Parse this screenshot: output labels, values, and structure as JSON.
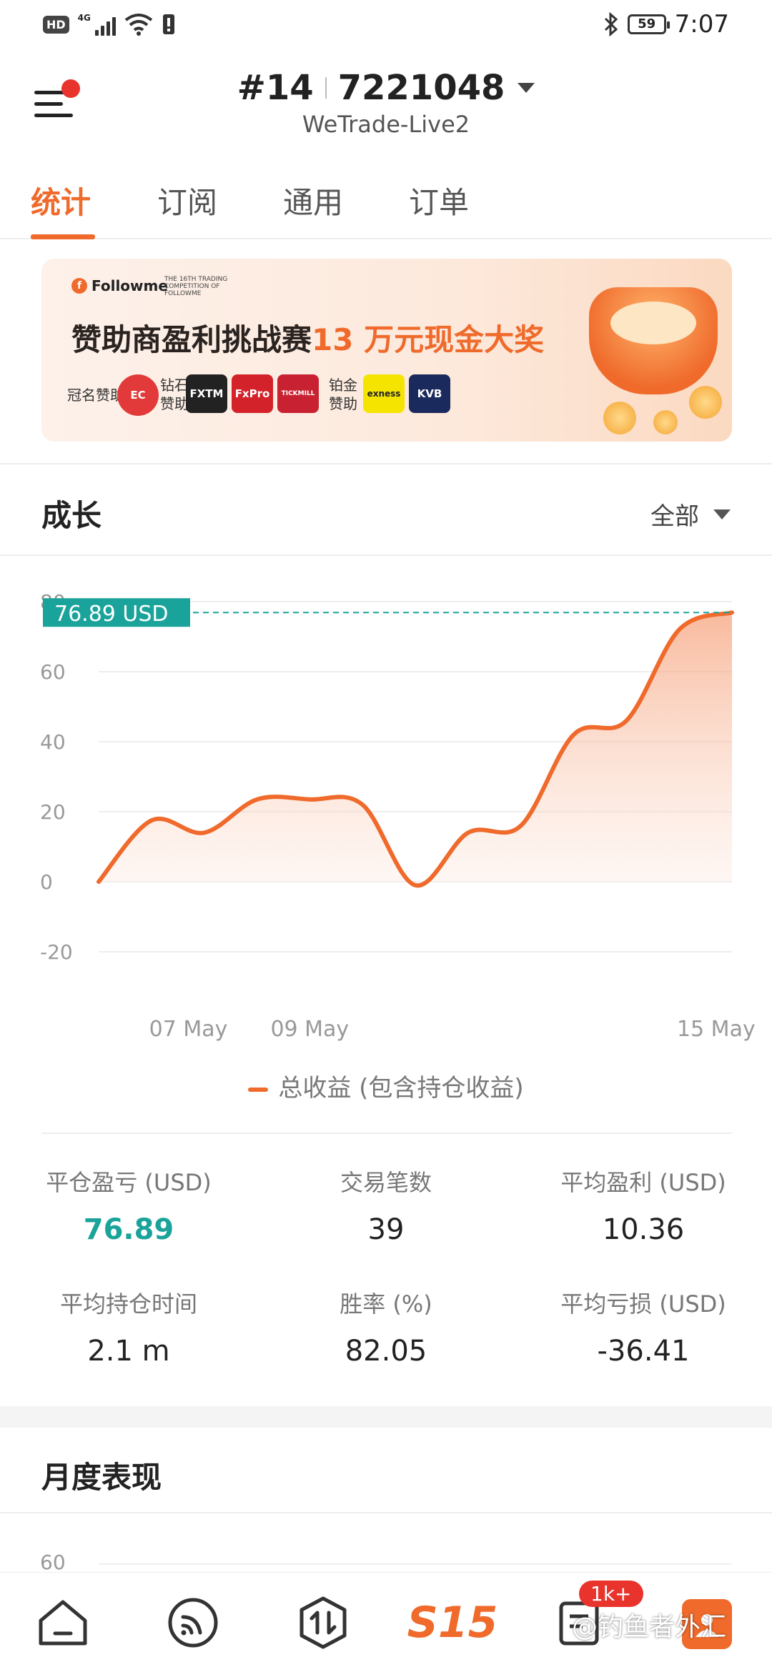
{
  "status_bar": {
    "network_label": "4G",
    "hd_label": "HD",
    "battery": "59",
    "time": "7:07"
  },
  "header": {
    "account_prefix": "#14",
    "account_number": "7221048",
    "server": "WeTrade-Live2"
  },
  "tabs": [
    {
      "label": "统计",
      "active": true
    },
    {
      "label": "订阅",
      "active": false
    },
    {
      "label": "通用",
      "active": false
    },
    {
      "label": "订单",
      "active": false
    }
  ],
  "banner": {
    "brand": "Followme",
    "competition": "THE 16TH TRADING COMPETITION OF FOLLOWME",
    "title_main": "赞助商盈利挑战赛",
    "title_highlight": "13 万元现金大奖",
    "title_sponsor": "冠名赞助",
    "diamond_sponsor": "钻石赞助",
    "platinum_sponsor": "铂金赞助",
    "logos": [
      "EC",
      "FXTM",
      "FxPro",
      "TICKMILL",
      "exness",
      "KVB"
    ]
  },
  "growth": {
    "title": "成长",
    "filter": "全部"
  },
  "chart_data": {
    "type": "area",
    "current_label": "76.89 USD",
    "current_value": 76.89,
    "ylim": [
      -20,
      80
    ],
    "yticks": [
      80,
      60,
      40,
      20,
      0,
      -20
    ],
    "xticks": [
      "07 May",
      "09 May",
      "15 May"
    ],
    "series": [
      {
        "name": "总收益 (包含持仓收益)",
        "x": [
          0,
          1,
          2,
          3,
          4,
          5,
          6,
          7,
          8,
          9,
          10,
          11,
          12
        ],
        "values": [
          0,
          17.5,
          14,
          23.5,
          23.5,
          22,
          -1,
          14,
          16,
          42,
          46,
          72,
          76.89
        ]
      }
    ],
    "colors": {
      "line": "#ef6a2b",
      "fill": "#fde2d4",
      "marker": "#1aa39a"
    }
  },
  "stats": [
    {
      "label": "平仓盈亏 (USD)",
      "value": "76.89",
      "color": "green"
    },
    {
      "label": "交易笔数",
      "value": "39",
      "color": "default"
    },
    {
      "label": "平均盈利 (USD)",
      "value": "10.36",
      "color": "default"
    },
    {
      "label": "平均持仓时间",
      "value": "2.1 m",
      "color": "default"
    },
    {
      "label": "胜率 (%)",
      "value": "82.05",
      "color": "default"
    },
    {
      "label": "平均亏损 (USD)",
      "value": "-36.41",
      "color": "default"
    }
  ],
  "monthly": {
    "title": "月度表现",
    "first_tick": "60"
  },
  "bottom_nav": {
    "items": [
      "home-icon",
      "feed-icon",
      "trade-icon",
      "S15",
      "orders-icon",
      "profile-icon"
    ],
    "badge": "1k+",
    "center_label": "S15"
  },
  "watermark": "@钓鱼者外汇",
  "colors": {
    "accent": "#ef6a2b",
    "positive": "#1aa39a"
  }
}
